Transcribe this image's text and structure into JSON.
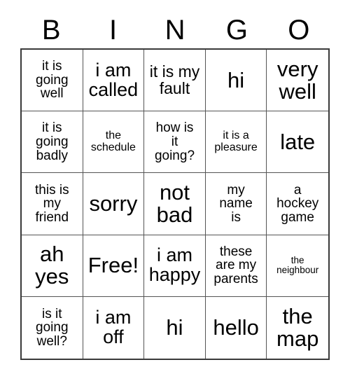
{
  "card": {
    "title": "BINGO",
    "headers": [
      "B",
      "I",
      "N",
      "G",
      "O"
    ],
    "free_space": {
      "row": 3,
      "col": 1,
      "label": "Free!"
    },
    "colors": {
      "background": "#ffffff",
      "text": "#000000",
      "outer_border": "#3a3a3a",
      "inner_border": "#555555"
    },
    "rows": [
      [
        {
          "text": "it is\ngoing\nwell",
          "size": "m"
        },
        {
          "text": "i am\ncalled",
          "size": "xl"
        },
        {
          "text": "it is my\nfault",
          "size": "l"
        },
        {
          "text": "hi",
          "size": "xxl"
        },
        {
          "text": "very\nwell",
          "size": "xxl"
        }
      ],
      [
        {
          "text": "it is\ngoing\nbadly",
          "size": "m"
        },
        {
          "text": "the\nschedule",
          "size": "s"
        },
        {
          "text": "how is\nit\ngoing?",
          "size": "m"
        },
        {
          "text": "it is a\npleasure",
          "size": "s"
        },
        {
          "text": "late",
          "size": "xxl"
        }
      ],
      [
        {
          "text": "this is\nmy\nfriend",
          "size": "m"
        },
        {
          "text": "sorry",
          "size": "xxl"
        },
        {
          "text": "not\nbad",
          "size": "xxl"
        },
        {
          "text": "my\nname\nis",
          "size": "m"
        },
        {
          "text": "a\nhockey\ngame",
          "size": "m"
        }
      ],
      [
        {
          "text": "ah\nyes",
          "size": "xxl"
        },
        {
          "text": "Free!",
          "size": "xxl"
        },
        {
          "text": "i am\nhappy",
          "size": "xl"
        },
        {
          "text": "these\nare my\nparents",
          "size": "m"
        },
        {
          "text": "the\nneighbour",
          "size": "xs"
        }
      ],
      [
        {
          "text": "is it\ngoing\nwell?",
          "size": "m"
        },
        {
          "text": "i am\noff",
          "size": "xl"
        },
        {
          "text": "hi",
          "size": "xxl"
        },
        {
          "text": "hello",
          "size": "xxl"
        },
        {
          "text": "the\nmap",
          "size": "xxl"
        }
      ]
    ]
  }
}
